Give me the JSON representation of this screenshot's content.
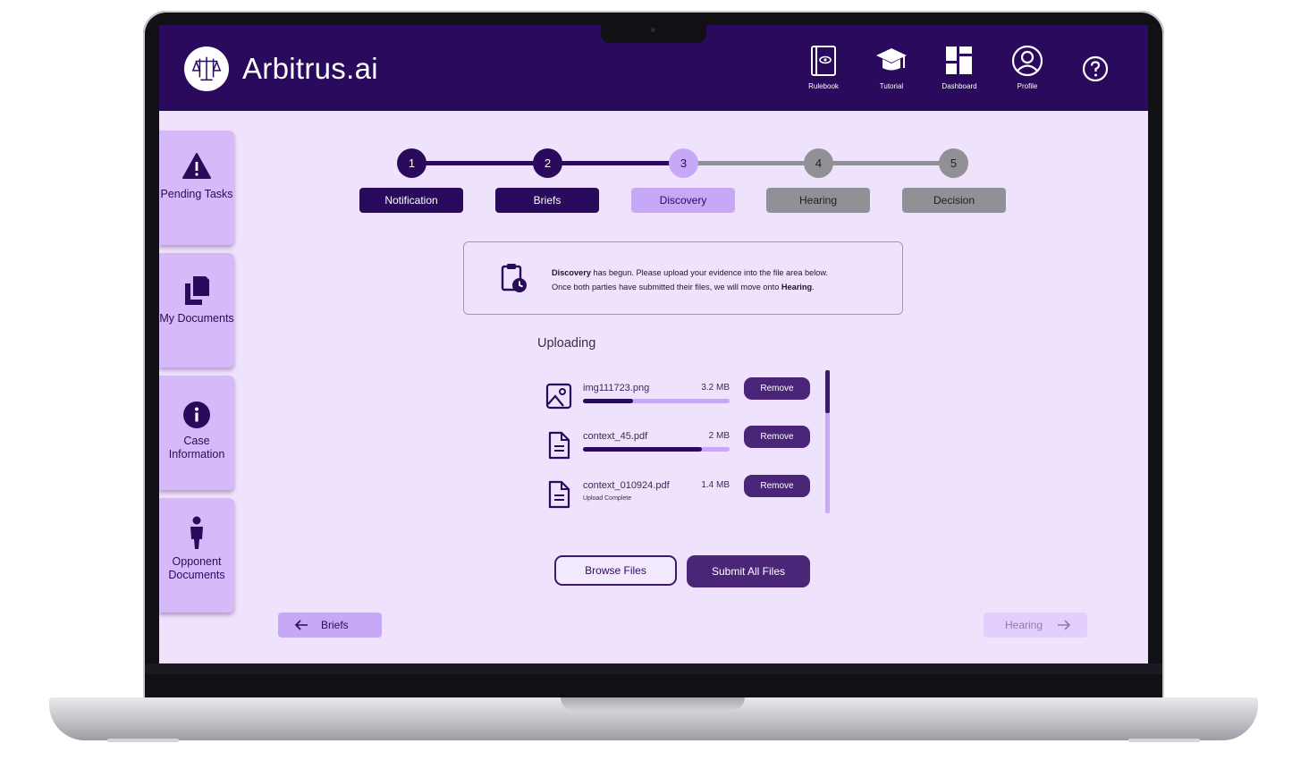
{
  "app": {
    "brand": "Arbitrus.ai"
  },
  "header_nav": [
    {
      "label": "Rulebook",
      "icon": "rulebook-icon"
    },
    {
      "label": "Tutorial",
      "icon": "graduation-cap-icon"
    },
    {
      "label": "Dashboard",
      "icon": "dashboard-icon"
    },
    {
      "label": "Profile",
      "icon": "profile-icon"
    }
  ],
  "sidebar": [
    {
      "label": "Pending Tasks",
      "icon": "warning-icon"
    },
    {
      "label": "My Documents",
      "icon": "documents-icon"
    },
    {
      "label": "Case Information",
      "icon": "info-icon"
    },
    {
      "label": "Opponent Documents",
      "icon": "person-icon"
    }
  ],
  "stepper": [
    {
      "number": "1",
      "label": "Notification",
      "state": "complete"
    },
    {
      "number": "2",
      "label": "Briefs",
      "state": "complete"
    },
    {
      "number": "3",
      "label": "Discovery",
      "state": "current"
    },
    {
      "number": "4",
      "label": "Hearing",
      "state": "pending"
    },
    {
      "number": "5",
      "label": "Decision",
      "state": "pending"
    }
  ],
  "notice": {
    "line1_bold": "Discovery",
    "line1_rest": " has begun. Please upload your evidence into the file area below.",
    "line2_rest": "Once both parties have submitted their files, we will move onto ",
    "line2_bold": "Hearing",
    "line2_end": "."
  },
  "uploads": {
    "title": "Uploading",
    "files": [
      {
        "name": "img111723.png",
        "size": "3.2 MB",
        "progress": 0.34,
        "status": "",
        "icon": "image-file-icon",
        "remove_label": "Remove"
      },
      {
        "name": "context_45.pdf",
        "size": "2 MB",
        "progress": 0.81,
        "status": "",
        "icon": "document-file-icon",
        "remove_label": "Remove"
      },
      {
        "name": "context_010924.pdf",
        "size": "1.4 MB",
        "progress": 1.0,
        "status": "Upload Complete",
        "icon": "document-file-icon",
        "remove_label": "Remove"
      }
    ],
    "scroll_position": 0.0
  },
  "actions": {
    "browse": "Browse Files",
    "submit": "Submit All Files"
  },
  "pager": {
    "back": "Briefs",
    "next": "Hearing"
  },
  "colors": {
    "header": "#2a0a5c",
    "background": "#efe2fd",
    "sidebar": "#d5b9f8",
    "accent": "#4a2578",
    "current_step": "#c7a8f6",
    "pending_step": "#919096"
  }
}
